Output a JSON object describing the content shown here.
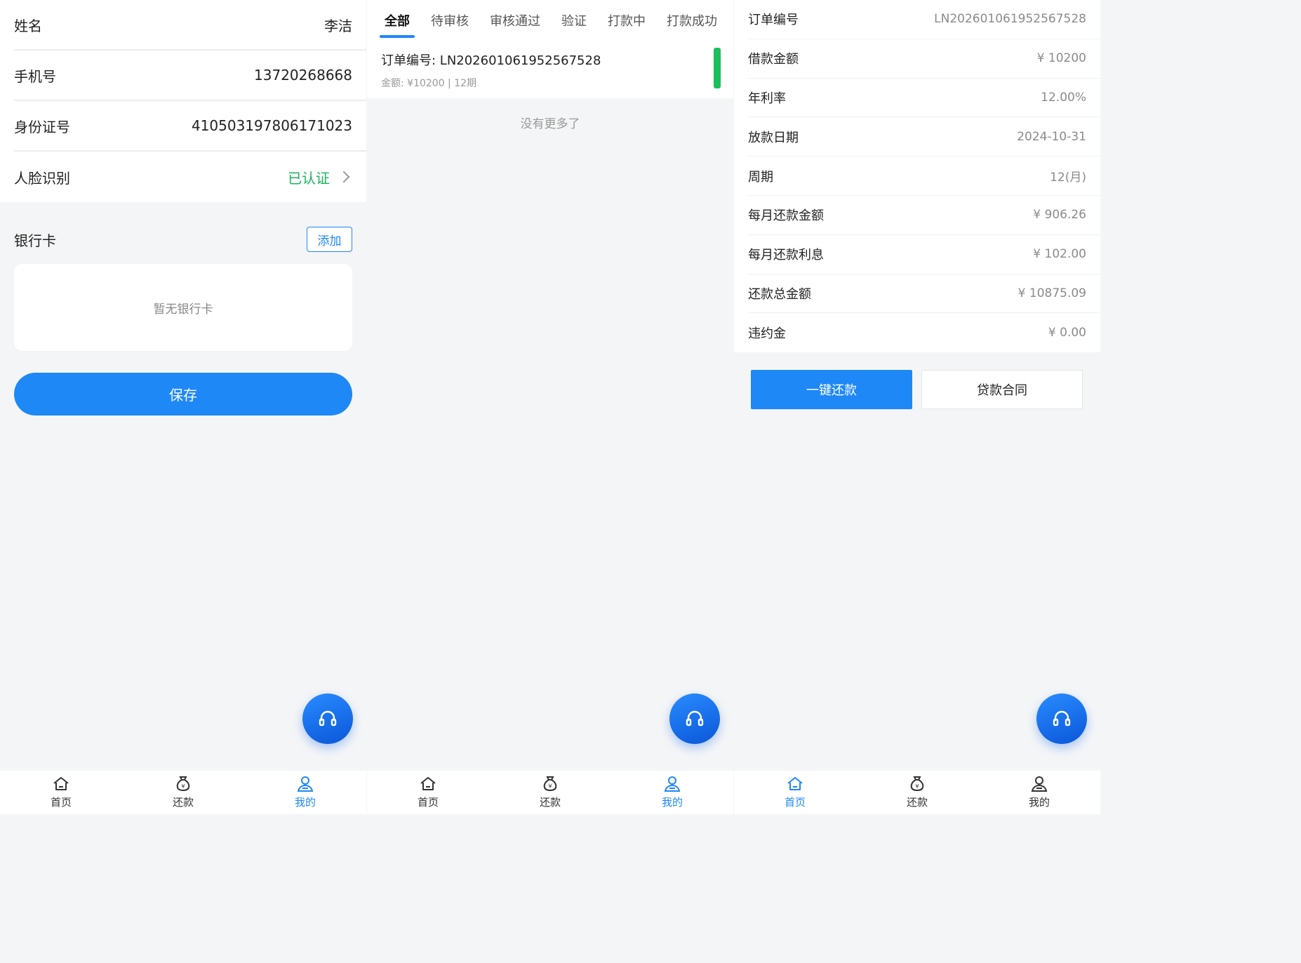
{
  "profile": {
    "rows": [
      {
        "label": "姓名",
        "value": "李洁"
      },
      {
        "label": "手机号",
        "value": "13720268668"
      },
      {
        "label": "身份证号",
        "value": "410503197806171023"
      }
    ],
    "face": {
      "label": "人脸识别",
      "value": "已认证"
    },
    "bank": {
      "title": "银行卡",
      "add_label": "添加",
      "empty_text": "暂无银行卡"
    },
    "save_label": "保存"
  },
  "orders": {
    "tabs": [
      "全部",
      "待审核",
      "审核通过",
      "验证",
      "打款中",
      "打款成功"
    ],
    "active_tab": "全部",
    "items": [
      {
        "order_no": "订单编号: LN202601061952567528",
        "summary": "金额: ¥10200 | 12期"
      }
    ],
    "no_more": "没有更多了"
  },
  "detail": {
    "rows": [
      {
        "label": "订单编号",
        "value": "LN202601061952567528"
      },
      {
        "label": "借款金额",
        "value": "¥ 10200"
      },
      {
        "label": "年利率",
        "value": "12.00%"
      },
      {
        "label": "放款日期",
        "value": "2024-10-31"
      },
      {
        "label": "周期",
        "value": "12(月)"
      },
      {
        "label": "每月还款金额",
        "value": "¥ 906.26"
      },
      {
        "label": "每月还款利息",
        "value": "¥ 102.00"
      },
      {
        "label": "还款总金额",
        "value": "¥ 10875.09"
      },
      {
        "label": "违约金",
        "value": "¥ 0.00"
      }
    ],
    "repay_label": "一键还款",
    "contract_label": "贷款合同"
  },
  "tabbar": {
    "home": "首页",
    "repay": "还款",
    "mine": "我的",
    "home_icon": "home-icon",
    "repay_icon": "money-bag-icon",
    "mine_icon": "user-icon"
  },
  "colors": {
    "primary": "#1e88f7",
    "success": "#18b55a",
    "background": "#f4f5f7"
  },
  "fab_icon": "headset-icon"
}
